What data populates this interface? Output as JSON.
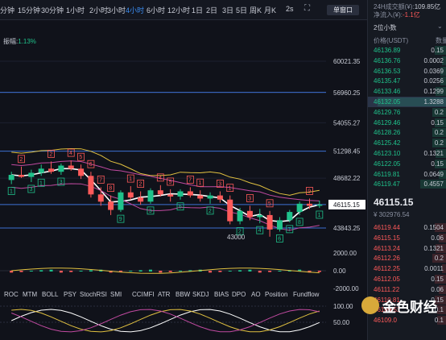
{
  "toolbar": {
    "timeframes": [
      "分钟",
      "15分钟",
      "30分钟",
      "1小时",
      "2小时",
      "3小时",
      "4小时",
      "6小时",
      "12小时",
      "1日",
      "2日",
      "3日",
      "5日",
      "周K",
      "月K"
    ],
    "active_timeframe": "4小时",
    "refresh_label": "2s",
    "window_button": "单窗口"
  },
  "chart": {
    "amplitude_label": "振幅:",
    "amplitude_value": "1.13%",
    "price_axis": [
      "60021.35",
      "56960.25",
      "54055.27",
      "51298.45",
      "48682.22",
      "46115.15",
      "43843.25"
    ],
    "low_marker": "43000",
    "macd_axis": [
      "2000.00",
      "0.00",
      "-2000.00"
    ],
    "osc_axis": [
      "100.00",
      "50.00"
    ],
    "indicators": [
      "ROC",
      "MTM",
      "BOLL",
      "PSY",
      "StochRSI",
      "SMI",
      "CCI",
      "MFI",
      "ATR",
      "BBW",
      "SKDJ",
      "BIAS",
      "DPO",
      "AO",
      "Position",
      "Fundflow"
    ],
    "td_counts": [
      "1",
      "2",
      "3",
      "1",
      "2",
      "3",
      "4",
      "5",
      "6",
      "7",
      "8",
      "9",
      "1",
      "2",
      "3",
      "4",
      "5",
      "6",
      "7"
    ]
  },
  "chart_data": {
    "type": "candlestick",
    "interval": "4小时",
    "current_price": 46115.15,
    "y_ticks": [
      60021.35,
      56960.25,
      54055.27,
      51298.45,
      48682.22,
      46115.15,
      43843.25
    ],
    "ohlc": [
      [
        48500,
        49300,
        48100,
        49000
      ],
      [
        49000,
        49800,
        48700,
        48800
      ],
      [
        48800,
        49500,
        48300,
        49200
      ],
      [
        49200,
        50000,
        48900,
        49600
      ],
      [
        49600,
        50300,
        49100,
        49300
      ],
      [
        49300,
        50100,
        49000,
        49900
      ],
      [
        49900,
        50400,
        49400,
        49600
      ],
      [
        49600,
        50000,
        48600,
        48900
      ],
      [
        48900,
        49300,
        46800,
        47100
      ],
      [
        47100,
        47800,
        46000,
        46400
      ],
      [
        46400,
        47000,
        45100,
        45600
      ],
      [
        45600,
        47500,
        45400,
        47300
      ],
      [
        47300,
        47900,
        46600,
        46800
      ],
      [
        46800,
        47400,
        46100,
        46400
      ],
      [
        46400,
        47700,
        46200,
        47500
      ],
      [
        47500,
        48000,
        46900,
        47100
      ],
      [
        47100,
        47600,
        46400,
        46900
      ],
      [
        46900,
        47600,
        46600,
        47400
      ],
      [
        47400,
        47800,
        46800,
        47000
      ],
      [
        47000,
        47500,
        46400,
        46700
      ],
      [
        46700,
        47300,
        46200,
        47000
      ],
      [
        47000,
        47400,
        46300,
        46600
      ],
      [
        46600,
        47000,
        44200,
        44500
      ],
      [
        44500,
        45800,
        44200,
        45500
      ],
      [
        45500,
        46000,
        44600,
        44900
      ],
      [
        44900,
        45700,
        44300,
        45100
      ],
      [
        45100,
        45500,
        43000,
        43700
      ],
      [
        43700,
        44900,
        43500,
        44600
      ],
      [
        44600,
        45600,
        44400,
        45400
      ],
      [
        45400,
        46400,
        45100,
        46200
      ],
      [
        46200,
        46700,
        45700,
        46000
      ],
      [
        46000,
        46500,
        45800,
        46115
      ]
    ]
  },
  "sidebar": {
    "volume_label": "24H成交额(¥):",
    "volume_value": "109.85亿",
    "inflow_label": "净流入(¥):",
    "inflow_value": "-1.1亿",
    "precision": "2位小数",
    "col_price": "价格(USDT)",
    "col_amount": "数量",
    "asks": [
      {
        "p": "46136.89",
        "a": "0.15"
      },
      {
        "p": "46136.76",
        "a": "0.0002"
      },
      {
        "p": "46136.53",
        "a": "0.0369"
      },
      {
        "p": "46135.47",
        "a": "0.0256"
      },
      {
        "p": "46133.46",
        "a": "0.1299"
      },
      {
        "p": "46132.05",
        "a": "1.3288"
      },
      {
        "p": "46129.76",
        "a": "0.2"
      },
      {
        "p": "46129.46",
        "a": "0.15"
      },
      {
        "p": "46128.26",
        "a": "0.2"
      },
      {
        "p": "46125.42",
        "a": "0.2"
      },
      {
        "p": "46123.10",
        "a": "0.1321"
      },
      {
        "p": "46122.05",
        "a": "0.15"
      },
      {
        "p": "46119.81",
        "a": "0.0649"
      },
      {
        "p": "46119.47",
        "a": "0.4557"
      }
    ],
    "last_price": "46115.15",
    "last_sub": "¥ 302976.54",
    "bids": [
      {
        "p": "46119.44",
        "a": "0.1504"
      },
      {
        "p": "46115.15",
        "a": "0.06"
      },
      {
        "p": "46113.24",
        "a": "0.1321"
      },
      {
        "p": "46112.26",
        "a": "0.2"
      },
      {
        "p": "46112.25",
        "a": "0.0011"
      },
      {
        "p": "46112.05",
        "a": "0.15"
      },
      {
        "p": "46111.22",
        "a": "0.06"
      },
      {
        "p": "46110.81",
        "a": "0.15"
      },
      {
        "p": "46109.51",
        "a": "0.1"
      },
      {
        "p": "46109.0",
        "a": "0.1"
      }
    ]
  },
  "watermark": "金色财经",
  "colors": {
    "up": "#1fc28b",
    "down": "#ff5a5a",
    "accent": "#3b8cf0"
  }
}
